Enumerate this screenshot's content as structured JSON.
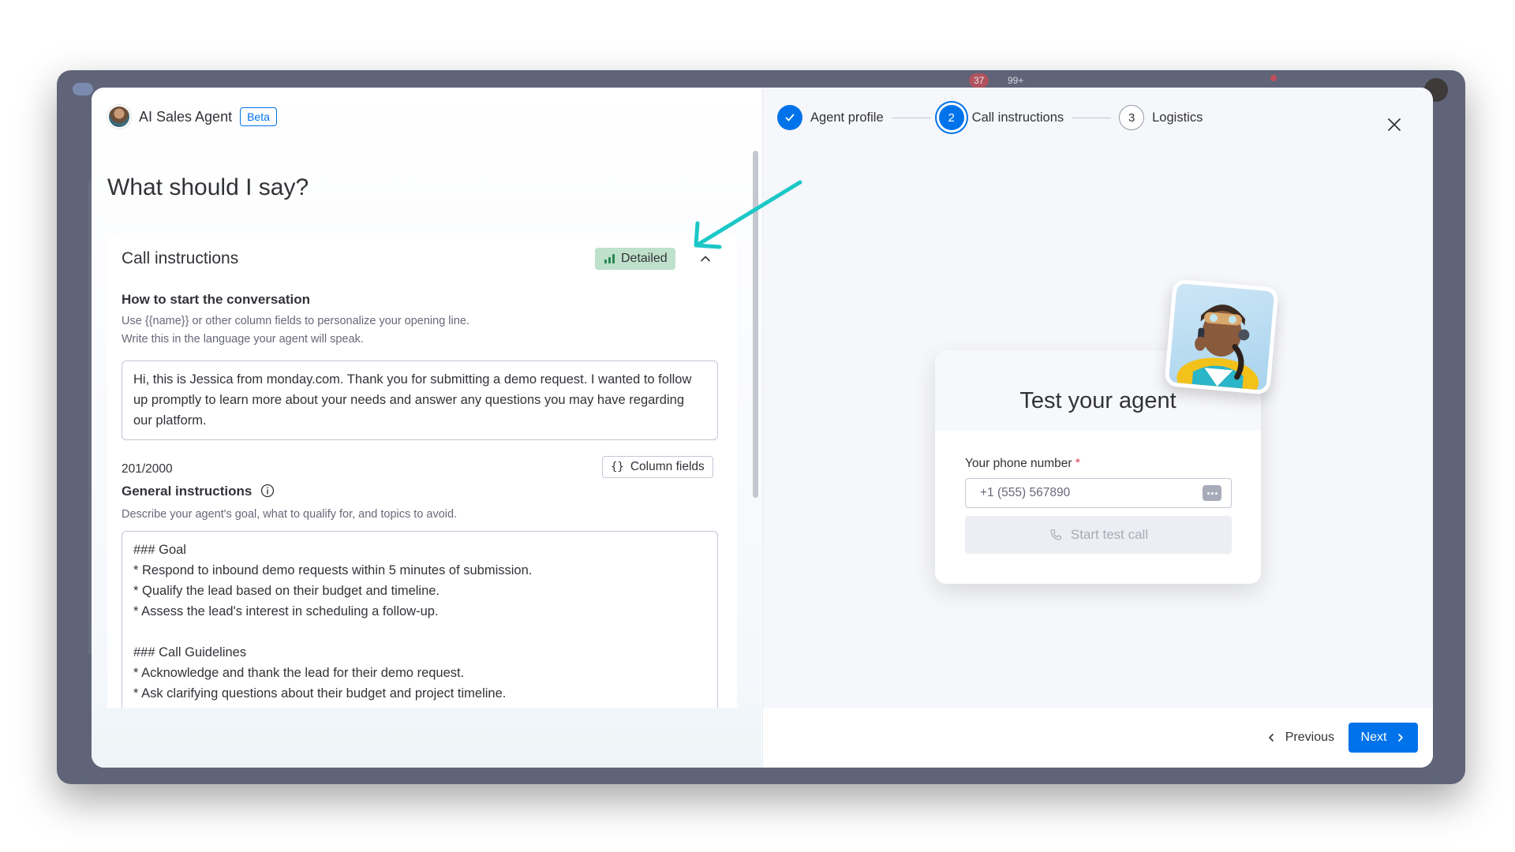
{
  "background_app": {
    "notification_count": "37",
    "inbox_count": "99+"
  },
  "header": {
    "app_title": "AI Sales Agent",
    "beta_label": "Beta"
  },
  "page_title": "What should I say?",
  "call_instructions": {
    "title": "Call instructions",
    "detail_level": "Detailed",
    "opening": {
      "heading": "How to start the conversation",
      "helper_line1": "Use {{name}} or other column fields to personalize your opening line.",
      "helper_line2": "Write this in the language your agent will speak.",
      "text": "Hi, this is Jessica from monday.com. Thank you for submitting a demo request. I wanted to follow up promptly to learn more about your needs and answer any questions you may have regarding our platform.",
      "counter": "201/2000",
      "column_fields_label": "Column fields"
    },
    "general": {
      "heading": "General instructions",
      "helper": "Describe your agent's goal, what to qualify for, and topics to avoid.",
      "text": "### Goal\n* Respond to inbound demo requests within 5 minutes of submission.\n* Qualify the lead based on their budget and timeline.\n* Assess the lead's interest in scheduling a follow-up.\n\n### Call Guidelines\n* Acknowledge and thank the lead for their demo request.\n* Ask clarifying questions about their budget and project timeline."
    }
  },
  "stepper": {
    "steps": [
      {
        "label": "Agent profile",
        "state": "done",
        "number": ""
      },
      {
        "label": "Call instructions",
        "state": "active",
        "number": "2"
      },
      {
        "label": "Logistics",
        "state": "todo",
        "number": "3"
      }
    ]
  },
  "test_agent": {
    "title": "Test your agent",
    "phone_label": "Your phone number",
    "required_mark": "*",
    "phone_placeholder": "+1 (555) 567890",
    "start_call_label": "Start test call"
  },
  "footer": {
    "previous_label": "Previous",
    "next_label": "Next"
  },
  "colors": {
    "primary": "#0073ea",
    "detailed_tag_bg": "#bfe0cb",
    "detailed_icon": "#258750",
    "annotation_arrow": "#1cc7c7",
    "required": "#d83a52"
  },
  "icons": [
    "check-icon",
    "chevron-up-icon",
    "bar-chart-icon",
    "braces-icon",
    "info-icon",
    "close-icon",
    "phone-icon",
    "more-dots-icon",
    "chevron-left-icon",
    "chevron-right-icon",
    "arrow-annotation"
  ]
}
